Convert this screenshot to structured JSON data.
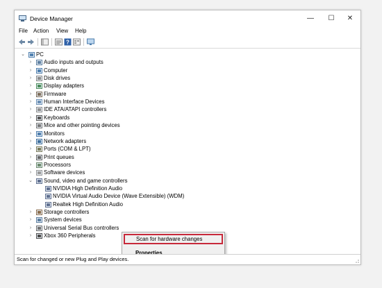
{
  "window": {
    "title": "Device Manager",
    "controls": {
      "minimize": "—",
      "maximize": "☐",
      "close": "✕"
    }
  },
  "menu": [
    "File",
    "Action",
    "View",
    "Help"
  ],
  "toolbar": [
    "back-icon",
    "forward-icon",
    "show-hide-tree-icon",
    "properties-icon",
    "help-icon",
    "view-icon",
    "monitor-icon"
  ],
  "tree": {
    "root": "PC",
    "categories": [
      {
        "label": "Audio inputs and outputs",
        "icon": "speaker-icon"
      },
      {
        "label": "Computer",
        "icon": "computer-icon"
      },
      {
        "label": "Disk drives",
        "icon": "disk-icon"
      },
      {
        "label": "Display adapters",
        "icon": "display-adapter-icon"
      },
      {
        "label": "Firmware",
        "icon": "firmware-icon"
      },
      {
        "label": "Human Interface Devices",
        "icon": "hid-icon"
      },
      {
        "label": "IDE ATA/ATAPI controllers",
        "icon": "ide-controller-icon"
      },
      {
        "label": "Keyboards",
        "icon": "keyboard-icon"
      },
      {
        "label": "Mice and other pointing devices",
        "icon": "mouse-icon"
      },
      {
        "label": "Monitors",
        "icon": "monitor-icon"
      },
      {
        "label": "Network adapters",
        "icon": "network-icon"
      },
      {
        "label": "Ports (COM & LPT)",
        "icon": "port-icon"
      },
      {
        "label": "Print queues",
        "icon": "printer-icon"
      },
      {
        "label": "Processors",
        "icon": "processor-icon"
      },
      {
        "label": "Software devices",
        "icon": "software-device-icon"
      },
      {
        "label": "Sound, video and game controllers",
        "icon": "sound-icon",
        "expanded": true
      },
      {
        "label": "Storage controllers",
        "icon": "storage-icon"
      },
      {
        "label": "System devices",
        "icon": "system-icon"
      },
      {
        "label": "Universal Serial Bus controllers",
        "icon": "usb-icon"
      },
      {
        "label": "Xbox 360 Peripherals",
        "icon": "gamepad-icon"
      }
    ],
    "sound_children": [
      "NVIDIA High Definition Audio",
      "NVIDIA Virtual Audio Device (Wave Extensible) (WDM)",
      "Realtek High Definition Audio"
    ]
  },
  "context_menu": {
    "scan": "Scan for hardware changes",
    "properties": "Properties"
  },
  "status": "Scan for changed or new Plug and Play devices.",
  "colors": {
    "highlight": "#c7283a"
  }
}
